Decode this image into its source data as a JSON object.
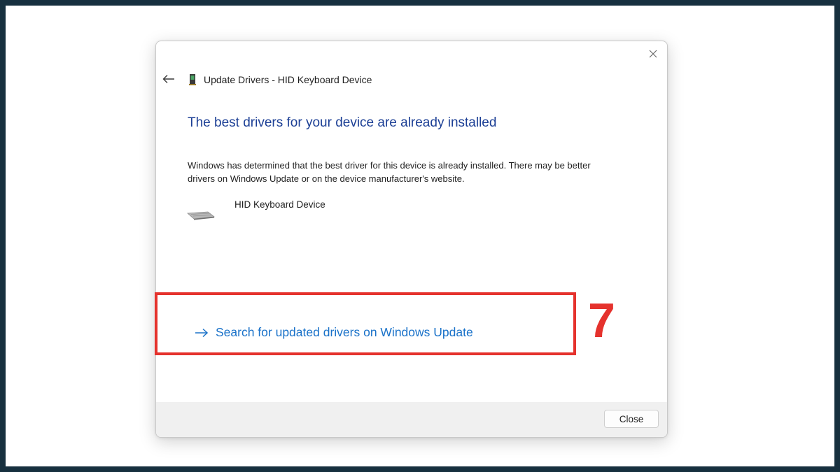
{
  "dialog": {
    "title": "Update Drivers - HID Keyboard Device",
    "heading": "The best drivers for your device are already installed",
    "description": "Windows has determined that the best driver for this device is already installed. There may be better drivers on Windows Update or on the device manufacturer's website.",
    "device_name": "HID Keyboard Device",
    "link_label": "Search for updated drivers on Windows Update",
    "close_button_label": "Close"
  },
  "annotation": {
    "step_number": "7",
    "color": "#e5322d"
  },
  "colors": {
    "heading": "#1c3f95",
    "link": "#1a72c9",
    "background_border": "#17303f"
  },
  "icons": [
    "close-icon",
    "back-arrow-icon",
    "device-icon",
    "keyboard-icon",
    "right-arrow-icon"
  ]
}
